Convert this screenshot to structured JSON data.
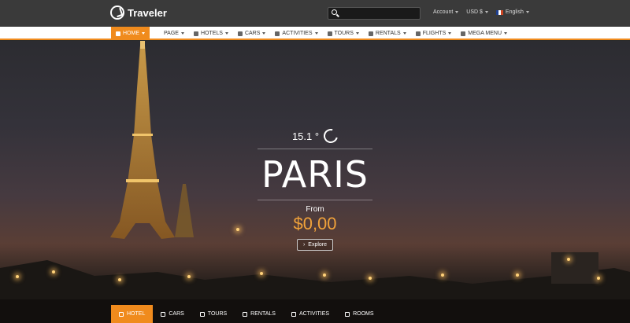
{
  "brand": {
    "name": "Traveler"
  },
  "search": {
    "placeholder": "",
    "value": ""
  },
  "top_links": [
    {
      "label": "Account"
    },
    {
      "label": "USD $"
    },
    {
      "label": "English"
    }
  ],
  "nav": {
    "home": "HOME",
    "items": [
      "PAGE",
      "HOTELS",
      "CARS",
      "ACTIVITIES",
      "TOURS",
      "RENTALS",
      "FLIGHTS",
      "MEGA MENU"
    ]
  },
  "hero": {
    "temperature": "15.1 °",
    "city": "PARIS",
    "from_label": "From",
    "price": "$0,00",
    "button_label": "Explore"
  },
  "tabs": [
    "HOTEL",
    "CARS",
    "TOURS",
    "RENTALS",
    "ACTIVITIES",
    "ROOMS"
  ],
  "colors": {
    "accent": "#f08b1d",
    "price": "#f0a23a",
    "topbar": "#3a3a3a"
  }
}
